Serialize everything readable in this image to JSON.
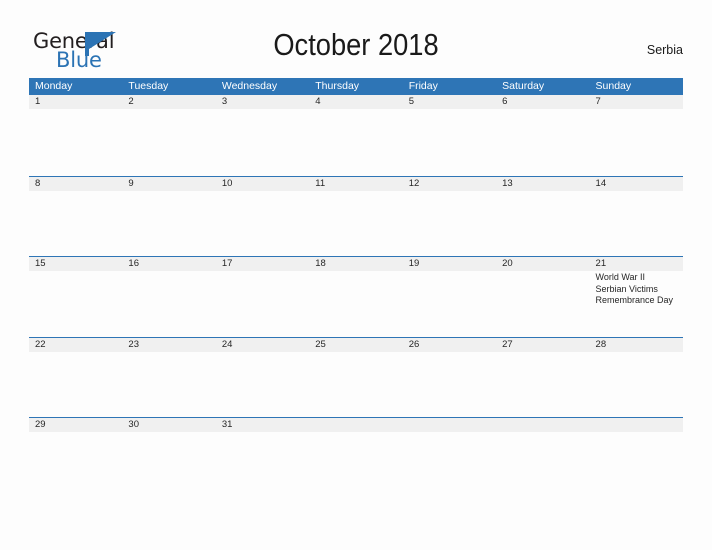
{
  "brand": {
    "name_part1": "General",
    "name_part2": "Blue",
    "flag_icon": "flag-icon",
    "primary_color": "#2b73b4"
  },
  "header": {
    "title": "October 2018",
    "region": "Serbia"
  },
  "calendar": {
    "weekdays": [
      "Monday",
      "Tuesday",
      "Wednesday",
      "Thursday",
      "Friday",
      "Saturday",
      "Sunday"
    ],
    "header_bg": "#2e75b6",
    "header_text_color": "#ffffff",
    "band_bg": "#f0f0f0",
    "row_border_color": "#2e75b6",
    "weeks": [
      {
        "days": [
          {
            "num": "1",
            "events": []
          },
          {
            "num": "2",
            "events": []
          },
          {
            "num": "3",
            "events": []
          },
          {
            "num": "4",
            "events": []
          },
          {
            "num": "5",
            "events": []
          },
          {
            "num": "6",
            "events": []
          },
          {
            "num": "7",
            "events": []
          }
        ]
      },
      {
        "days": [
          {
            "num": "8",
            "events": []
          },
          {
            "num": "9",
            "events": []
          },
          {
            "num": "10",
            "events": []
          },
          {
            "num": "11",
            "events": []
          },
          {
            "num": "12",
            "events": []
          },
          {
            "num": "13",
            "events": []
          },
          {
            "num": "14",
            "events": []
          }
        ]
      },
      {
        "days": [
          {
            "num": "15",
            "events": []
          },
          {
            "num": "16",
            "events": []
          },
          {
            "num": "17",
            "events": []
          },
          {
            "num": "18",
            "events": []
          },
          {
            "num": "19",
            "events": []
          },
          {
            "num": "20",
            "events": []
          },
          {
            "num": "21",
            "events": [
              "World War II",
              "Serbian Victims",
              "Remembrance Day"
            ]
          }
        ]
      },
      {
        "days": [
          {
            "num": "22",
            "events": []
          },
          {
            "num": "23",
            "events": []
          },
          {
            "num": "24",
            "events": []
          },
          {
            "num": "25",
            "events": []
          },
          {
            "num": "26",
            "events": []
          },
          {
            "num": "27",
            "events": []
          },
          {
            "num": "28",
            "events": []
          }
        ]
      },
      {
        "days": [
          {
            "num": "29",
            "events": []
          },
          {
            "num": "30",
            "events": []
          },
          {
            "num": "31",
            "events": []
          },
          {
            "num": "",
            "events": []
          },
          {
            "num": "",
            "events": []
          },
          {
            "num": "",
            "events": []
          },
          {
            "num": "",
            "events": []
          }
        ]
      }
    ]
  }
}
